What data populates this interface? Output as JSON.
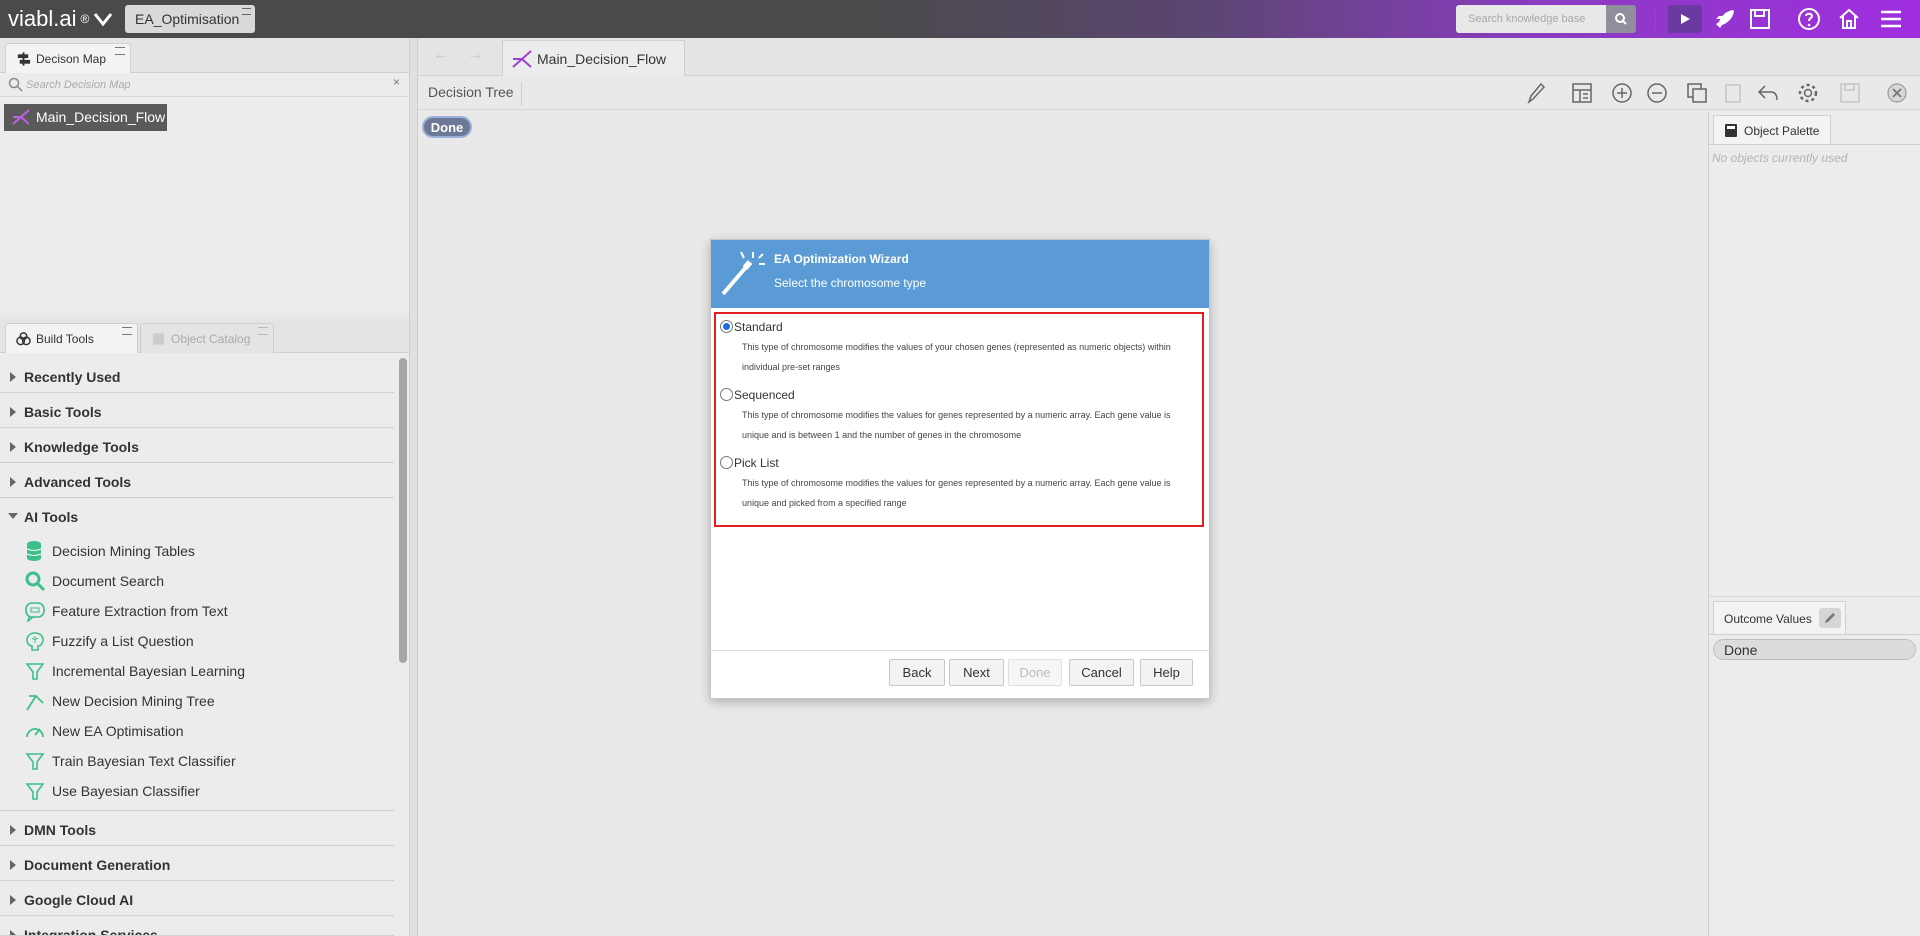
{
  "topbar": {
    "logo_text": "viabl.ai",
    "logo_reg": "®",
    "project_tab": "EA_Optimisation",
    "search_placeholder": "Search knowledge base",
    "brand_color": "#8a3cc0"
  },
  "decision_map": {
    "tab_label": "Decison Map",
    "search_placeholder": "Search Decision Map",
    "node_label": "Main_Decision_Flow"
  },
  "build_tools": {
    "tab_label": "Build Tools",
    "catalog_tab_label": "Object Catalog",
    "categories_before": [
      "Recently Used",
      "Basic Tools",
      "Knowledge Tools",
      "Advanced Tools"
    ],
    "open_category": "AI Tools",
    "ai_tools": [
      {
        "label": "Decision Mining Tables",
        "icon": "database-icon"
      },
      {
        "label": "Document Search",
        "icon": "magnifier-icon"
      },
      {
        "label": "Feature Extraction from Text",
        "icon": "chat-bubble-icon"
      },
      {
        "label": "Fuzzify a List Question",
        "icon": "brain-icon"
      },
      {
        "label": "Incremental Bayesian Learning",
        "icon": "funnel-icon"
      },
      {
        "label": "New Decision Mining Tree",
        "icon": "mining-tree-icon"
      },
      {
        "label": "New EA Optimisation",
        "icon": "gauge-icon"
      },
      {
        "label": "Train Bayesian Text Classifier",
        "icon": "funnel-icon"
      },
      {
        "label": "Use Bayesian Classifier",
        "icon": "funnel-icon"
      }
    ],
    "categories_after": [
      "DMN Tools",
      "Document Generation",
      "Google Cloud AI",
      "Integration Services"
    ]
  },
  "editor": {
    "doc_tab": "Main_Decision_Flow",
    "toolbar_label": "Decision Tree",
    "done_node": "Done"
  },
  "object_palette": {
    "tab_label": "Object Palette",
    "empty_text": "No objects currently used"
  },
  "outcome_values": {
    "tab_label": "Outcome Values",
    "items": [
      "Done"
    ]
  },
  "wizard": {
    "title": "EA Optimization Wizard",
    "subtitle": "Select the chromosome type",
    "header_color": "#5b9bd5",
    "options": [
      {
        "label": "Standard",
        "selected": true,
        "description": "This type of chromosome modifies the values of your chosen genes (represented as numeric objects) within individual pre-set ranges"
      },
      {
        "label": "Sequenced",
        "selected": false,
        "description": "This type of chromosome modifies the values for genes represented by a numeric array. Each gene value is unique and is between 1 and the number of genes in the chromosome"
      },
      {
        "label": "Pick List",
        "selected": false,
        "description": "This type of chromosome modifies the values for genes represented by a numeric array. Each gene value is unique and picked from a specified range"
      }
    ],
    "buttons": {
      "back": "Back",
      "next": "Next",
      "done": "Done",
      "cancel": "Cancel",
      "help": "Help"
    }
  }
}
